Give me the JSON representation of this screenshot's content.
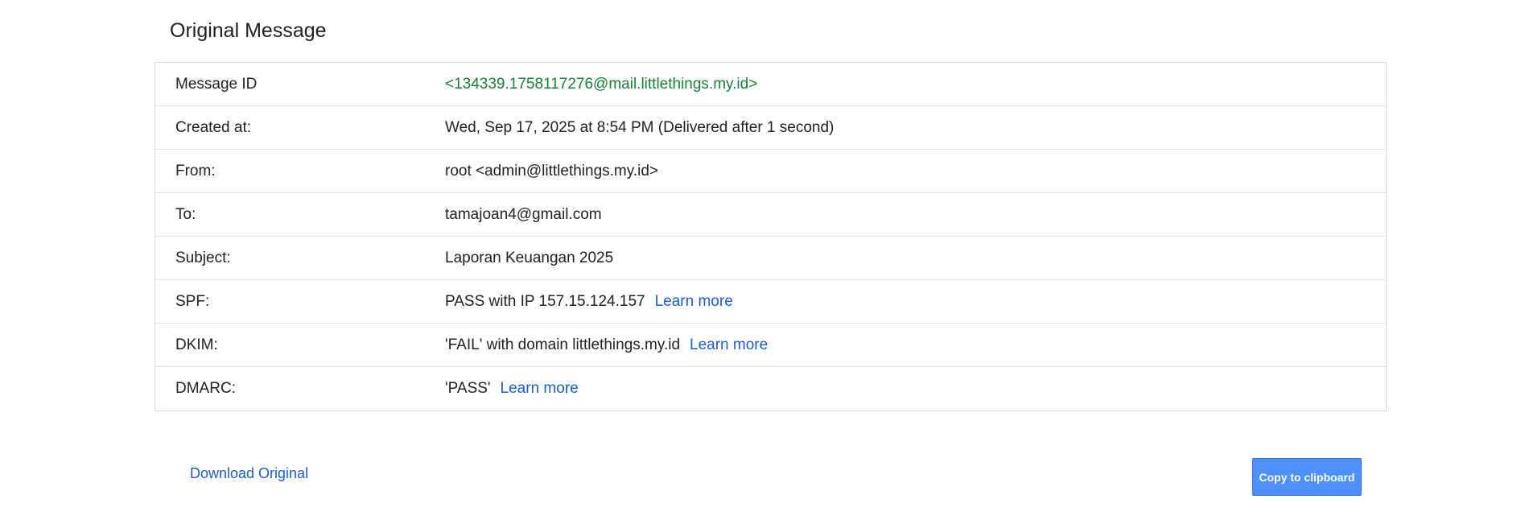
{
  "page": {
    "title": "Original Message"
  },
  "details": {
    "message_id": {
      "label": "Message ID",
      "value": "<134339.1758117276@mail.littlethings.my.id>"
    },
    "created_at": {
      "label": "Created at:",
      "value": "Wed, Sep 17, 2025 at 8:54 PM (Delivered after 1 second)"
    },
    "from": {
      "label": "From:",
      "value": "root <admin@littlethings.my.id>"
    },
    "to": {
      "label": "To:",
      "value": "tamajoan4@gmail.com"
    },
    "subject": {
      "label": "Subject:",
      "value": "Laporan Keuangan 2025"
    },
    "spf": {
      "label": "SPF:",
      "value": "PASS with IP 157.15.124.157",
      "link": "Learn more"
    },
    "dkim": {
      "label": "DKIM:",
      "value": "'FAIL' with domain littlethings.my.id",
      "link": "Learn more"
    },
    "dmarc": {
      "label": "DMARC:",
      "value": "'PASS'",
      "link": "Learn more"
    }
  },
  "actions": {
    "download_label": "Download Original",
    "copy_label": "Copy to clipboard"
  },
  "colors": {
    "link": "#1a5fc7",
    "message_id": "#188038",
    "button": "#4d90fe"
  }
}
